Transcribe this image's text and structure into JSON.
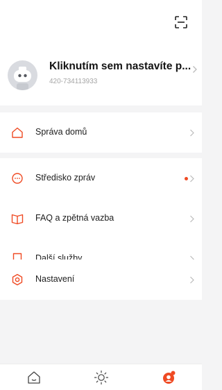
{
  "header": {
    "scan_icon": "scan-icon"
  },
  "profile": {
    "name": "Kliknutím sem nastavíte p...",
    "phone": "420-734113933",
    "avatar_icon": "robot-avatar-icon"
  },
  "menu": {
    "home_management": "Správa domů",
    "message_center": "Středisko zpráv",
    "faq_feedback": "FAQ a zpětná vazba",
    "more_services": "Další služby",
    "settings": "Nastavení"
  },
  "tabs": [
    {
      "icon": "home-icon",
      "active": false
    },
    {
      "icon": "sun-icon",
      "active": false
    },
    {
      "icon": "user-icon",
      "active": true
    }
  ],
  "colors": {
    "accent": "#ef4a23",
    "background": "#f4f4f5",
    "card": "#ffffff",
    "text": "#1c1c1c",
    "muted": "#a5a5a5",
    "icon_gray": "#9a9a9a"
  }
}
